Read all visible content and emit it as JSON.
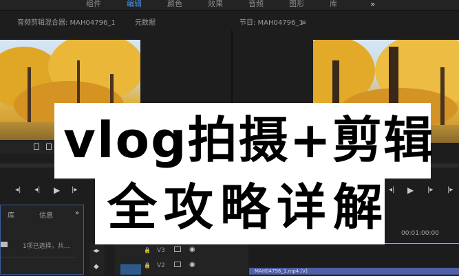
{
  "workspace": {
    "tabs": [
      {
        "label": "组件",
        "active": false
      },
      {
        "label": "编辑",
        "active": true
      },
      {
        "label": "颜色",
        "active": false
      },
      {
        "label": "效果",
        "active": false
      },
      {
        "label": "音频",
        "active": false
      },
      {
        "label": "图形",
        "active": false
      },
      {
        "label": "库",
        "active": false
      }
    ],
    "more": "»"
  },
  "source_panel": {
    "audio_mixer_label": "音频剪辑混合器: MAH04796_1",
    "metadata_label": "元数据"
  },
  "program_panel": {
    "label": "节目: MAH04796_1",
    "menu": "≡"
  },
  "project_panel": {
    "tab_library": "库",
    "tab_info": "信息",
    "more": "»",
    "status": "1项已选择，共..."
  },
  "timeline": {
    "timecode": "00:01:00:00",
    "tracks": [
      "V3",
      "V2"
    ],
    "clip_label": "MAH04796_1.mp4 [V]"
  },
  "title_card": {
    "line1": "vlog拍摄+剪辑",
    "line2": "全攻略详解"
  },
  "colors": {
    "accent": "#4b8fe0",
    "clip": "#4f5fa8",
    "panel_border": "#3a5f9a"
  }
}
